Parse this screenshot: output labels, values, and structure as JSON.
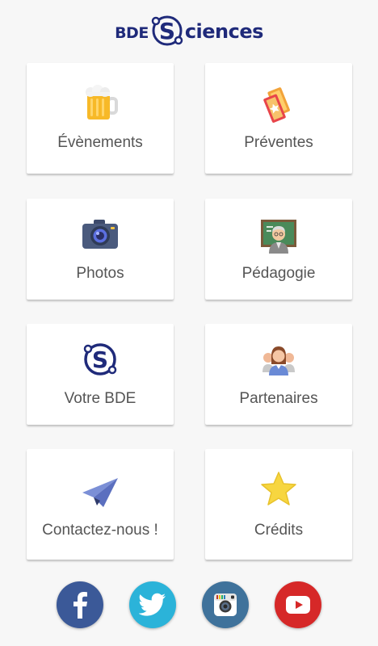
{
  "header": {
    "logo_text_left": "BDE",
    "logo_letter": "S",
    "logo_text_right": "ciences"
  },
  "menu": {
    "items": [
      {
        "label": "Évènements"
      },
      {
        "label": "Préventes"
      },
      {
        "label": "Photos"
      },
      {
        "label": "Pédagogie"
      },
      {
        "label": "Votre BDE"
      },
      {
        "label": "Partenaires"
      },
      {
        "label": "Contactez-nous !"
      },
      {
        "label": "Crédits"
      }
    ]
  },
  "social": {
    "items": [
      {
        "name": "facebook",
        "color": "#3b5998"
      },
      {
        "name": "twitter",
        "color": "#2bb3d9"
      },
      {
        "name": "instagram",
        "color": "#3f729b"
      },
      {
        "name": "youtube",
        "color": "#d62828"
      }
    ]
  }
}
